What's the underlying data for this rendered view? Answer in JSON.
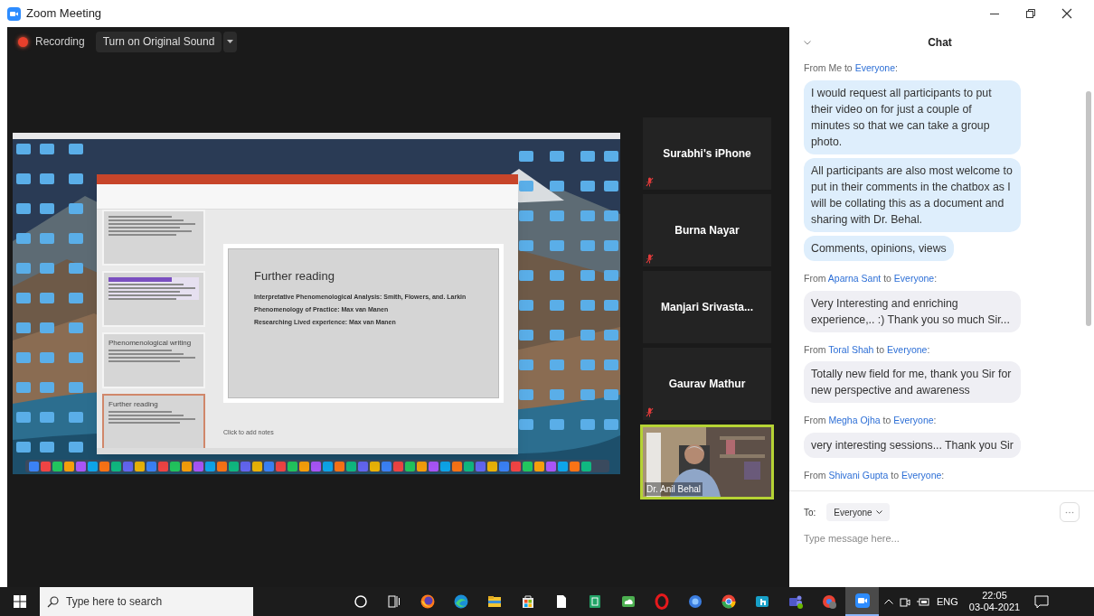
{
  "window": {
    "title": "Zoom Meeting"
  },
  "recording": {
    "label": "Recording",
    "sound_button": "Turn on Original Sound"
  },
  "shared_screen": {
    "slide": {
      "title": "Further reading",
      "bullets": [
        "Interpretative Phenomenological Analysis: Smith, Flowers, and. Larkin",
        "Phenomenology of Practice: Max van Manen",
        "Researching Lived experience: Max van Manen"
      ]
    },
    "thumbnails": [
      {
        "kind": "text",
        "selected": false
      },
      {
        "kind": "table",
        "selected": false
      },
      {
        "kind": "text",
        "title": "Phenomenological writing",
        "selected": false
      },
      {
        "kind": "text",
        "title": "Further reading",
        "selected": true
      }
    ],
    "notes_placeholder": "Click to add notes"
  },
  "participants": [
    {
      "name": "Surabhi's iPhone",
      "muted": true
    },
    {
      "name": "Burna Nayar",
      "muted": true
    },
    {
      "name": "Manjari  Srivasta...",
      "muted": false
    },
    {
      "name": "Gaurav Mathur",
      "muted": true
    }
  ],
  "active_speaker": {
    "name": "Dr. Anil Behal"
  },
  "chat": {
    "title": "Chat",
    "messages": [
      {
        "kind": "sent",
        "header": [
          {
            "kind": "plain",
            "text": "From"
          },
          {
            "kind": "plain",
            "text": "Me"
          },
          {
            "kind": "plain",
            "text": "to"
          },
          {
            "kind": "name",
            "text": "Everyone"
          },
          {
            "kind": "tail",
            "text": ":"
          }
        ],
        "texts": [
          "I would request all participants to put their video on for just a couple of minutes so that we can take a group photo.",
          "All participants are also most welcome to put in their comments in the chatbox as I will be collating this as a document and sharing with Dr. Behal.",
          "Comments, opinions, views"
        ]
      },
      {
        "kind": "received",
        "header": [
          {
            "kind": "plain",
            "text": "From"
          },
          {
            "kind": "name",
            "text": "Aparna Sant"
          },
          {
            "kind": "plain",
            "text": "to"
          },
          {
            "kind": "name",
            "text": "Everyone"
          },
          {
            "kind": "tail",
            "text": ":"
          }
        ],
        "texts": [
          "Very Interesting and enriching experience,.. :) Thank you so much Sir..."
        ]
      },
      {
        "kind": "received",
        "header": [
          {
            "kind": "plain",
            "text": "From"
          },
          {
            "kind": "name",
            "text": "Toral Shah"
          },
          {
            "kind": "plain",
            "text": "to"
          },
          {
            "kind": "name",
            "text": "Everyone"
          },
          {
            "kind": "tail",
            "text": ":"
          }
        ],
        "texts": [
          "Totally new field for me, thank you Sir for new perspective and awareness"
        ]
      },
      {
        "kind": "received",
        "header": [
          {
            "kind": "plain",
            "text": "From"
          },
          {
            "kind": "name",
            "text": "Megha Ojha"
          },
          {
            "kind": "plain",
            "text": "to"
          },
          {
            "kind": "name",
            "text": "Everyone"
          },
          {
            "kind": "tail",
            "text": ":"
          }
        ],
        "texts": [
          "very interesting sessions... Thank you Sir"
        ]
      },
      {
        "header": [
          {
            "kind": "plain",
            "text": "From"
          },
          {
            "kind": "name",
            "text": "Shivani Gupta"
          },
          {
            "kind": "plain",
            "text": "to"
          },
          {
            "kind": "name",
            "text": "Everyone"
          },
          {
            "kind": "tail",
            "text": ":"
          }
        ]
      }
    ],
    "compose": {
      "to_label": "To:",
      "recipient": "Everyone",
      "placeholder": "Type message here..."
    }
  },
  "taskbar": {
    "search_placeholder": "Type here to search",
    "apps": [
      {
        "kind": "cortana",
        "active": false
      },
      {
        "kind": "taskview",
        "active": false
      },
      {
        "kind": "firefox",
        "active": false
      },
      {
        "kind": "edge",
        "active": false
      },
      {
        "kind": "explorer",
        "active": false
      },
      {
        "kind": "store",
        "active": false
      },
      {
        "kind": "file",
        "active": false
      },
      {
        "kind": "sheet",
        "active": false
      },
      {
        "kind": "cloud",
        "active": false
      },
      {
        "kind": "opera",
        "active": false
      },
      {
        "kind": "ring",
        "active": false
      },
      {
        "kind": "chrome",
        "active": false
      },
      {
        "kind": "hand",
        "active": false
      },
      {
        "kind": "teams",
        "active": false
      },
      {
        "kind": "chrome2",
        "active": false
      },
      {
        "kind": "zoom",
        "active": true
      }
    ],
    "language": "ENG",
    "time": "22:05",
    "date": "03-04-2021"
  }
}
